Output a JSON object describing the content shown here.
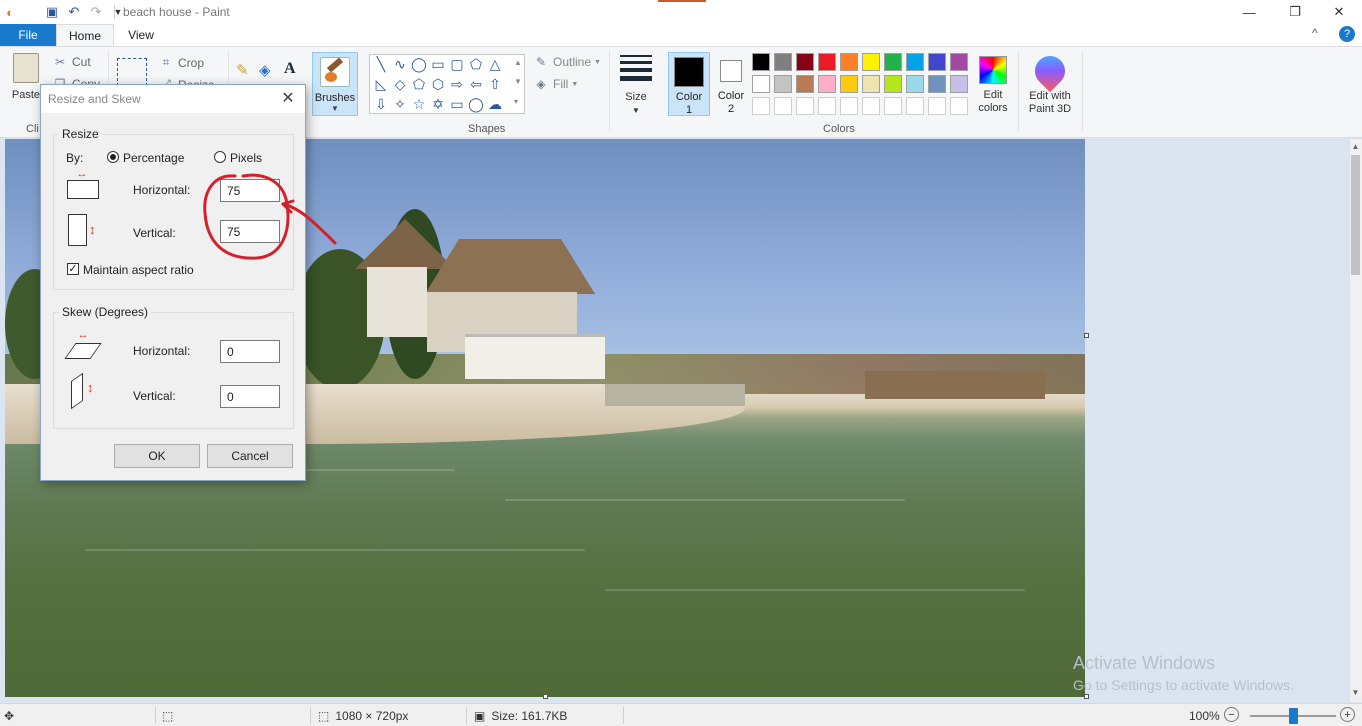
{
  "window": {
    "title": "beach house - Paint",
    "minimize_glyph": "—",
    "restore_glyph": "❐",
    "close_glyph": "✕",
    "help_glyph": "?",
    "collapse_glyph": "^"
  },
  "tabs": {
    "file": "File",
    "home": "Home",
    "view": "View"
  },
  "ribbon": {
    "clipboard": {
      "paste": "Paste",
      "cut": "Cut",
      "copy": "Copy",
      "group_label": "Cli"
    },
    "image": {
      "crop": "Crop",
      "resize": "Resize"
    },
    "brushes": "Brushes",
    "shapes_label": "Shapes",
    "outline": "Outline",
    "fill": "Fill",
    "size": "Size",
    "color1": "Color",
    "color1_num": "1",
    "color2": "Color",
    "color2_num": "2",
    "edit_colors_1": "Edit",
    "edit_colors_2": "colors",
    "edit_p3d_1": "Edit with",
    "edit_p3d_2": "Paint 3D",
    "colors_label": "Colors",
    "color1_value": "#000000",
    "color2_value": "#ffffff",
    "palette_row1": [
      "#000000",
      "#7f7f7f",
      "#880015",
      "#ed1c24",
      "#ff7f27",
      "#fff200",
      "#22b14c",
      "#00a2e8",
      "#3f48cc",
      "#a349a4"
    ],
    "palette_row2": [
      "#ffffff",
      "#c3c3c3",
      "#b97a57",
      "#ffaec9",
      "#ffc90e",
      "#efe4b0",
      "#b5e61d",
      "#99d9ea",
      "#7092be",
      "#c8bfe7"
    ]
  },
  "dialog": {
    "title": "Resize and Skew",
    "resize_group": "Resize",
    "by": "By:",
    "percentage": "Percentage",
    "pixels": "Pixels",
    "horizontal": "Horizontal:",
    "vertical": "Vertical:",
    "resize_h": "75",
    "resize_v": "75",
    "maintain": "Maintain aspect ratio",
    "skew_group": "Skew (Degrees)",
    "skew_h": "0",
    "skew_v": "0",
    "ok": "OK",
    "cancel": "Cancel"
  },
  "status": {
    "dimensions": "1080 × 720px",
    "size": "Size: 161.7KB",
    "zoom": "100%",
    "zoom_level": 0.5,
    "minus": "−",
    "plus": "+"
  },
  "watermark": {
    "line1": "Activate Windows",
    "line2": "Go to Settings to activate Windows."
  }
}
